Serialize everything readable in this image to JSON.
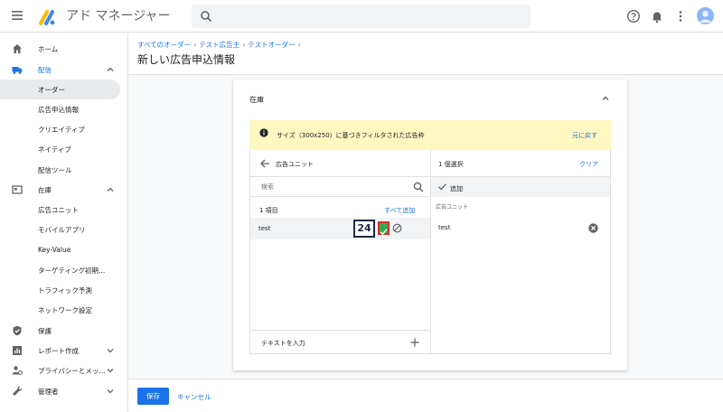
{
  "app": {
    "title": "アド マネージャー"
  },
  "search": {
    "placeholder": ""
  },
  "sidebar": {
    "items": [
      {
        "label": "ホーム",
        "icon": "home-icon"
      },
      {
        "label": "配信",
        "icon": "truck-icon"
      },
      {
        "label": "オーダー"
      },
      {
        "label": "広告申込情報"
      },
      {
        "label": "クリエイティブ"
      },
      {
        "label": "ネイティブ"
      },
      {
        "label": "配信ツール"
      },
      {
        "label": "在庫",
        "icon": "inventory-icon"
      },
      {
        "label": "広告ユニット"
      },
      {
        "label": "モバイルアプリ"
      },
      {
        "label": "Key-Value"
      },
      {
        "label": "ターゲティング初期..."
      },
      {
        "label": "トラフィック予測"
      },
      {
        "label": "ネットワーク設定"
      },
      {
        "label": "保護",
        "icon": "shield-icon"
      },
      {
        "label": "レポート作成",
        "icon": "report-icon"
      },
      {
        "label": "プライバシーとメッ...",
        "icon": "privacy-icon"
      },
      {
        "label": "管理者",
        "icon": "wrench-icon"
      }
    ]
  },
  "breadcrumbs": [
    "すべてのオーダー",
    "テスト広告主",
    "テストオーダー"
  ],
  "page": {
    "title": "新しい広告申込情報"
  },
  "card": {
    "title": "在庫",
    "banner": {
      "text": "サイズ（300x250）に基づきフィルタされた広告枠",
      "link": "元に戻す"
    },
    "left": {
      "title": "広告ユニット",
      "search_placeholder": "検索",
      "count": "1 項目",
      "add_all": "すべて追加",
      "row_label": "test",
      "badge": "24",
      "footer_label": "テキストを入力"
    },
    "right": {
      "count": "1 個選択",
      "clear": "クリア",
      "sub_label": "追加",
      "caption": "広告ユニット",
      "item": "test"
    }
  },
  "actions": {
    "save": "保存",
    "cancel": "キャンセル"
  },
  "colors": {
    "accent": "#1a73e8",
    "banner": "#fef7c0",
    "check": "#34a853",
    "highlight_border": "#d93025"
  }
}
